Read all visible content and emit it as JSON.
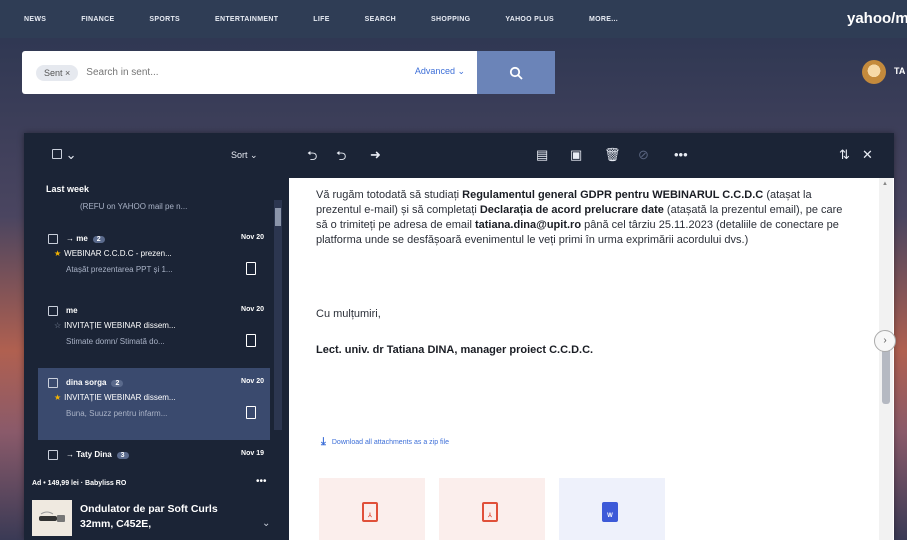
{
  "topnav": {
    "items": [
      "NEWS",
      "FINANCE",
      "SPORTS",
      "ENTERTAINMENT",
      "LIFE",
      "SEARCH",
      "SHOPPING",
      "YAHOO PLUS",
      "MORE..."
    ],
    "brand": "yahoo/mail"
  },
  "search": {
    "chip": "Sent",
    "placeholder": "Search in sent...",
    "advanced_label": "Advanced"
  },
  "user": {
    "avatar_text": "TA"
  },
  "toolbar": {
    "sort_label": "Sort"
  },
  "list": {
    "section": "Last week",
    "top_preview": "(REFU on YAHOO mail pe n...",
    "items": [
      {
        "sender": "me",
        "count": "2",
        "date": "Nov 20",
        "subject": "WEBINAR C.C.D.C - prezen...",
        "preview": "Atașăt prezentarea PPT și 1...",
        "starred": true
      },
      {
        "sender": "me",
        "count": "",
        "date": "Nov 20",
        "subject": "INVITAȚIE WEBINAR dissem...",
        "preview": "Stimate domn/ Stimată do...",
        "starred": false
      },
      {
        "sender": "dina sorga",
        "count": "2",
        "date": "Nov 20",
        "subject": "INVITAȚIE WEBINAR dissem...",
        "preview": "Buna, Suuzz pentru infarm...",
        "starred": true
      },
      {
        "sender": "Taty Dina",
        "count": "3",
        "date": "Nov 19",
        "subject": "",
        "preview": "",
        "starred": false
      }
    ],
    "ad": {
      "label": "Ad • 149,99 lei · Babyliss RO",
      "more": "•••",
      "title": "Ondulator de par Soft Curls 32mm, C452E,"
    }
  },
  "message": {
    "p1_a": "Vă rugăm totodată să studiați ",
    "p1_b": "Regulamentul general GDPR pentru WEBINARUL C.C.D.C",
    "p1_c": " (atașat la prezentul e-mail) și să completați ",
    "p1_d": "Declarația de acord prelucrare date",
    "p1_e": " (atașată la prezentul email), pe care să o trimiteți pe adresa de email ",
    "p1_f": "tatiana.dina@upit.ro",
    "p1_g": " până cel târziu 25.11.2023 (detaliile de conectare pe platforma unde se desfășoară evenimentul le veți primi în urma exprimării acordului dvs.)",
    "thanks": "Cu mulțumiri,",
    "signature": "Lect. univ. dr Tatiana DINA, manager proiect C.C.D.C.",
    "download": "Download all attachments as a zip file"
  },
  "colors": {
    "nav_bg": "#2f3d55",
    "dark_panel": "#1b2436",
    "selected": "#3a4a6e",
    "link": "#3d6fd8",
    "star": "#f5b400",
    "pdf": "#e0503a",
    "doc": "#3d5ad8"
  }
}
